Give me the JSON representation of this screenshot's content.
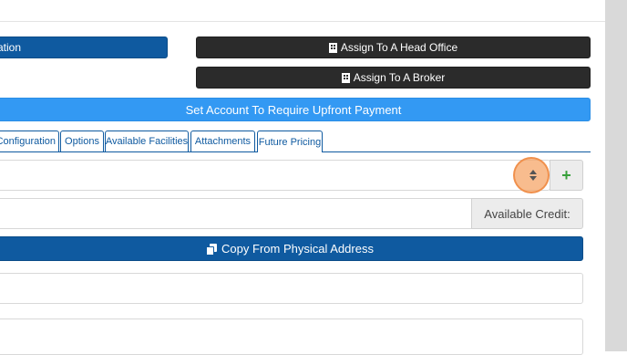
{
  "buttons": {
    "location_partial": "ation",
    "assign_head_office": "Assign To A Head Office",
    "assign_broker": "Assign To A Broker",
    "require_upfront_payment": "Set Account To Require Upfront Payment",
    "copy_from_physical": "Copy From Physical Address"
  },
  "tabs": [
    {
      "label": "Configuration"
    },
    {
      "label": "Options"
    },
    {
      "label": "Available Facilities"
    },
    {
      "label": "Attachments"
    },
    {
      "label": "Future Pricing"
    }
  ],
  "form": {
    "available_credit_label": "Available Credit:",
    "add_symbol": "+"
  },
  "icons": {
    "building": "building-icon",
    "copy": "copy-icon",
    "sort": "sort-icon",
    "plus": "plus-icon"
  },
  "colors": {
    "primary": "#0f5aa0",
    "dark": "#2b2b2b",
    "accent": "#3399f3",
    "add": "#37a03a",
    "cursor": "#f5a668"
  }
}
